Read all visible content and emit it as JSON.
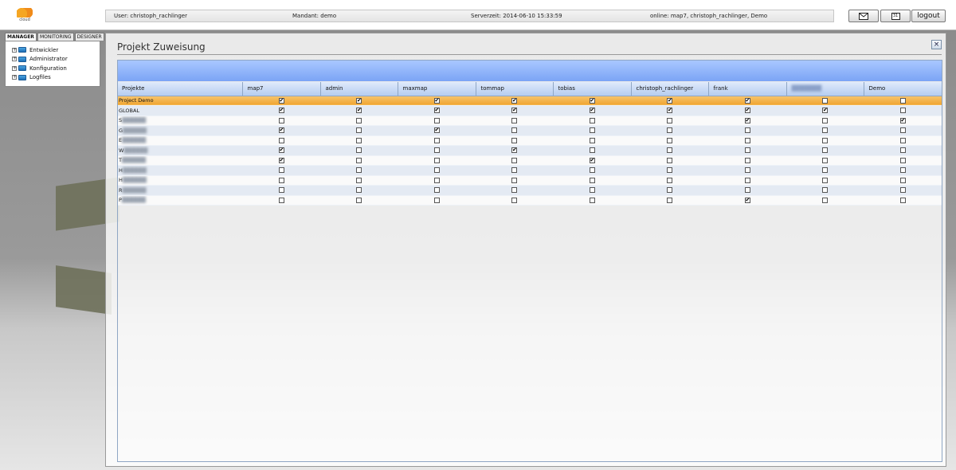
{
  "header": {
    "logo_text": "cloud",
    "user": "User: christoph_rachlinger",
    "mandant": "Mandant: demo",
    "serverzeit": "Serverzeit: 2014-06-10 15:33:59",
    "online": "online: map7, christoph_rachlinger, Demo",
    "buttons": {
      "mail_icon": "envelope-icon",
      "calendar_icon": "calendar-icon",
      "calendar_glyph": "31",
      "logout_label": "logout"
    }
  },
  "sidebar": {
    "tabs": [
      "MANAGER",
      "MONITORING",
      "DESIGNER"
    ],
    "active_tab": "MANAGER",
    "tree": [
      "Entwickler",
      "Administrator",
      "Konfiguration",
      "Logfiles"
    ]
  },
  "main": {
    "title": "Projekt Zuweisung",
    "close_glyph": "×",
    "columns": [
      "Projekte",
      "map7",
      "admin",
      "maxmap",
      "tommap",
      "tobias",
      "christoph_rachlinger",
      "frank",
      "",
      "Demo"
    ],
    "rows": [
      {
        "name": "Project Demo",
        "checks": [
          1,
          1,
          1,
          1,
          1,
          1,
          1,
          0,
          0
        ],
        "selected": true
      },
      {
        "name": "GLOBAL",
        "checks": [
          1,
          1,
          1,
          1,
          1,
          1,
          1,
          1,
          0
        ]
      },
      {
        "name": "S",
        "checks": [
          0,
          0,
          0,
          0,
          0,
          0,
          1,
          0,
          1
        ]
      },
      {
        "name": "G",
        "checks": [
          1,
          0,
          1,
          0,
          0,
          0,
          0,
          0,
          0
        ]
      },
      {
        "name": "E",
        "checks": [
          0,
          0,
          0,
          0,
          0,
          0,
          0,
          0,
          0
        ]
      },
      {
        "name": "W",
        "checks": [
          1,
          0,
          0,
          1,
          0,
          0,
          0,
          0,
          0
        ]
      },
      {
        "name": "T",
        "checks": [
          1,
          0,
          0,
          0,
          1,
          0,
          0,
          0,
          0
        ]
      },
      {
        "name": "H",
        "checks": [
          0,
          0,
          0,
          0,
          0,
          0,
          0,
          0,
          0
        ]
      },
      {
        "name": "H",
        "checks": [
          0,
          0,
          0,
          0,
          0,
          0,
          0,
          0,
          0
        ]
      },
      {
        "name": "R",
        "checks": [
          0,
          0,
          0,
          0,
          0,
          0,
          0,
          0,
          0
        ]
      },
      {
        "name": "P",
        "checks": [
          0,
          0,
          0,
          0,
          0,
          0,
          1,
          0,
          0
        ]
      }
    ]
  },
  "colors": {
    "selected_row": "#f0a531",
    "header_band": "#7ba4f5",
    "accent": "#f5a623"
  }
}
